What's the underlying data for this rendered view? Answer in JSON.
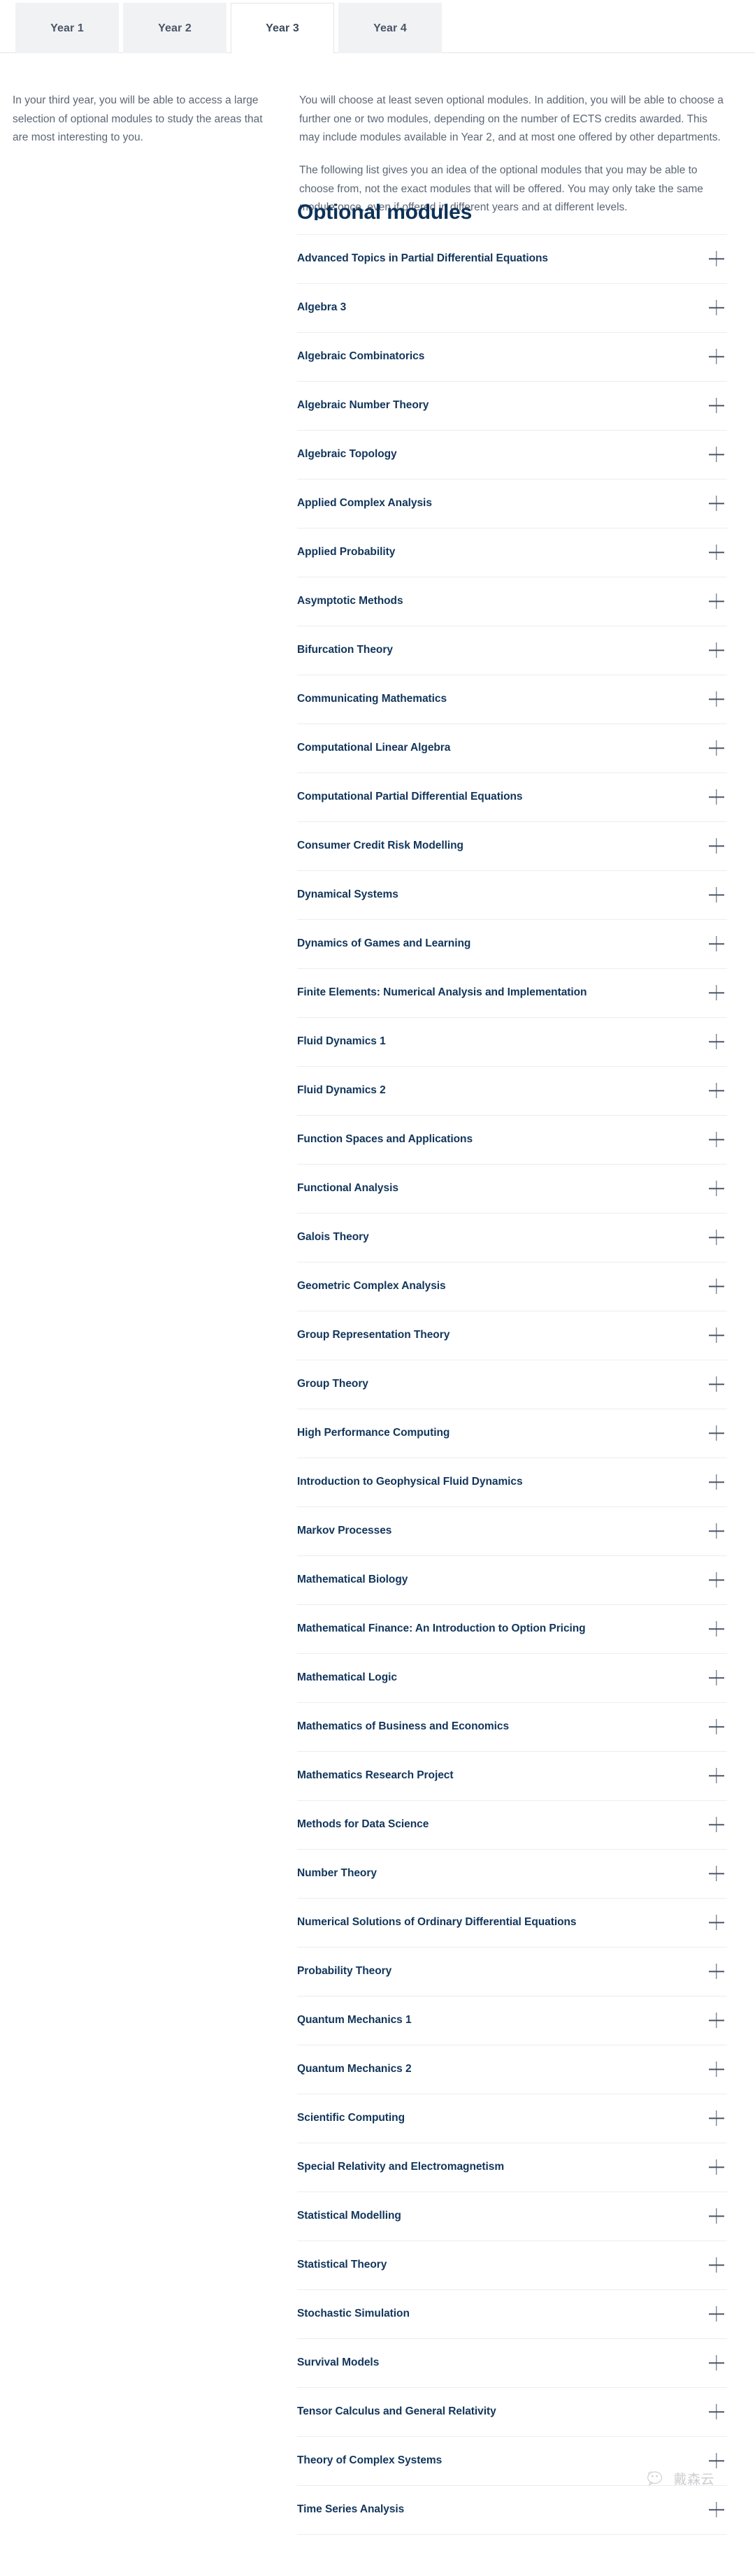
{
  "tabs": [
    {
      "label": "Year 1",
      "active": false
    },
    {
      "label": "Year 2",
      "active": false
    },
    {
      "label": "Year 3",
      "active": true
    },
    {
      "label": "Year 4",
      "active": false
    }
  ],
  "intro": {
    "left_paragraph": "In your third year, you will be able to access a large selection of optional modules to study the areas that are most interesting to you.",
    "right_paragraph_1": "You will choose at least seven optional modules. In addition, you will be able to choose a further one or two modules, depending on the number of ECTS credits awarded. This may include modules available in Year 2, and at most one offered by other departments.",
    "right_paragraph_2": "The following list gives you an idea of the optional modules that you may be able to choose from, not the exact modules that will be offered. You may only take the same module once, even if offered in different years and at different levels."
  },
  "modules": {
    "heading": "Optional modules",
    "expand_icon": "plus-icon",
    "items": [
      "Advanced Topics in Partial Differential Equations",
      "Algebra 3",
      "Algebraic Combinatorics",
      "Algebraic Number Theory",
      "Algebraic Topology",
      "Applied Complex Analysis",
      "Applied Probability",
      "Asymptotic Methods",
      "Bifurcation Theory",
      "Communicating Mathematics",
      "Computational Linear Algebra",
      "Computational Partial Differential Equations",
      "Consumer Credit Risk Modelling",
      "Dynamical Systems",
      "Dynamics of Games and Learning",
      "Finite Elements: Numerical Analysis and Implementation",
      "Fluid Dynamics 1",
      "Fluid Dynamics 2",
      "Function Spaces and Applications",
      "Functional Analysis",
      "Galois Theory",
      "Geometric Complex Analysis",
      "Group Representation Theory",
      "Group Theory",
      "High Performance Computing",
      "Introduction to Geophysical Fluid Dynamics",
      "Markov Processes",
      "Mathematical Biology",
      "Mathematical Finance: An Introduction to Option Pricing",
      "Mathematical Logic",
      "Mathematics of Business and Economics",
      "Mathematics Research Project",
      "Methods for Data Science",
      "Number Theory",
      "Numerical Solutions of Ordinary Differential Equations",
      "Probability Theory",
      "Quantum Mechanics 1",
      "Quantum Mechanics 2",
      "Scientific Computing",
      "Special Relativity and Electromagnetism",
      "Statistical Modelling",
      "Statistical Theory",
      "Stochastic Simulation",
      "Survival Models",
      "Tensor Calculus and General Relativity",
      "Theory of Complex Systems",
      "Time Series Analysis"
    ]
  },
  "watermark": {
    "icon": "wechat-icon",
    "text": "戴森云"
  },
  "colors": {
    "heading": "#0d3157",
    "module_label": "#12355b",
    "body_text": "#5c6776",
    "tab_text": "#4a5568",
    "divider": "#ebedef",
    "tab_inactive_bg": "#f1f2f3"
  }
}
